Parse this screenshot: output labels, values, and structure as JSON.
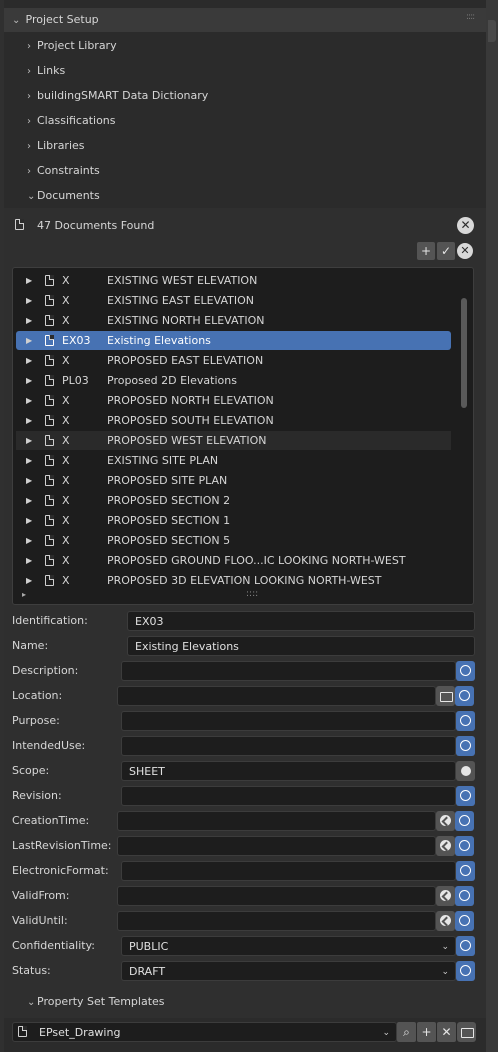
{
  "sections": {
    "project_setup": "Project Setup",
    "items": [
      {
        "label": "Project Library",
        "expanded": false
      },
      {
        "label": "Links",
        "expanded": false
      },
      {
        "label": "buildingSMART Data Dictionary",
        "expanded": false
      },
      {
        "label": "Classifications",
        "expanded": false
      },
      {
        "label": "Libraries",
        "expanded": false
      },
      {
        "label": "Constraints",
        "expanded": false
      },
      {
        "label": "Documents",
        "expanded": true
      }
    ]
  },
  "documents": {
    "found_label": "47 Documents Found",
    "rows": [
      {
        "id": "X",
        "name": "EXISTING WEST ELEVATION"
      },
      {
        "id": "X",
        "name": "EXISTING EAST ELEVATION"
      },
      {
        "id": "X",
        "name": "EXISTING NORTH ELEVATION"
      },
      {
        "id": "EX03",
        "name": "Existing Elevations",
        "selected": true
      },
      {
        "id": "X",
        "name": "PROPOSED EAST ELEVATION"
      },
      {
        "id": "PL03",
        "name": "Proposed 2D Elevations"
      },
      {
        "id": "X",
        "name": "PROPOSED NORTH ELEVATION"
      },
      {
        "id": "X",
        "name": "PROPOSED SOUTH ELEVATION"
      },
      {
        "id": "X",
        "name": "PROPOSED WEST ELEVATION",
        "hover": true
      },
      {
        "id": "X",
        "name": "EXISTING SITE PLAN"
      },
      {
        "id": "X",
        "name": "PROPOSED SITE PLAN"
      },
      {
        "id": "X",
        "name": "PROPOSED SECTION 2"
      },
      {
        "id": "X",
        "name": "PROPOSED SECTION 1"
      },
      {
        "id": "X",
        "name": "PROPOSED SECTION 5"
      },
      {
        "id": "X",
        "name": "PROPOSED GROUND FLOO...IC LOOKING NORTH-WEST"
      },
      {
        "id": "X",
        "name": "PROPOSED 3D ELEVATION LOOKING NORTH-WEST"
      }
    ]
  },
  "props": {
    "identification": {
      "label": "Identification:",
      "value": "EX03"
    },
    "name": {
      "label": "Name:",
      "value": "Existing Elevations"
    },
    "description": {
      "label": "Description:",
      "value": ""
    },
    "location": {
      "label": "Location:",
      "value": ""
    },
    "purpose": {
      "label": "Purpose:",
      "value": ""
    },
    "intended_use": {
      "label": "IntendedUse:",
      "value": ""
    },
    "scope": {
      "label": "Scope:",
      "value": "SHEET"
    },
    "revision": {
      "label": "Revision:",
      "value": ""
    },
    "creation_time": {
      "label": "CreationTime:",
      "value": ""
    },
    "last_revision_time": {
      "label": "LastRevisionTime:",
      "value": ""
    },
    "electronic_format": {
      "label": "ElectronicFormat:",
      "value": ""
    },
    "valid_from": {
      "label": "ValidFrom:",
      "value": ""
    },
    "valid_until": {
      "label": "ValidUntil:",
      "value": ""
    },
    "confidentiality": {
      "label": "Confidentiality:",
      "value": "PUBLIC"
    },
    "status": {
      "label": "Status:",
      "value": "DRAFT"
    }
  },
  "pset": {
    "title": "Property Set Templates",
    "selected": "EPset_Drawing"
  },
  "colors": {
    "accent": "#4772b3",
    "panel": "#2b2b2b",
    "field": "#1d1d1d"
  }
}
